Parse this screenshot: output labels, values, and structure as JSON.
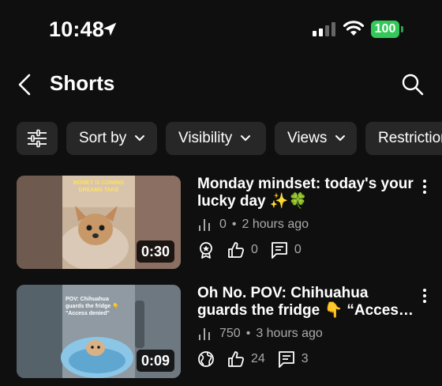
{
  "status_bar": {
    "time": "10:48",
    "battery": "100"
  },
  "header": {
    "title": "Shorts"
  },
  "filters": [
    {
      "label": "Sort by"
    },
    {
      "label": "Visibility"
    },
    {
      "label": "Views"
    },
    {
      "label": "Restrictions"
    }
  ],
  "videos": [
    {
      "title": "Monday mindset: today's your lucky day ✨🍀",
      "thumb_text": "MONEY IS COMING DREAMS TAKE",
      "duration": "0:30",
      "views": "0",
      "age": "2 hours ago",
      "likes": "0",
      "comments": "0",
      "visibility_icon": "award-icon"
    },
    {
      "title": "Oh No. POV: Chihuahua guards the fridge 👇 “Access denied” 🐶",
      "thumb_text": "POV: Chihuahua guards the fridge 👇 \"Access denied\"",
      "duration": "0:09",
      "views": "750",
      "age": "3 hours ago",
      "likes": "24",
      "comments": "3",
      "visibility_icon": "globe-icon"
    }
  ],
  "colors": {
    "background": "#0f0f0f",
    "chip": "#272727",
    "secondary_text": "#aaaaaa",
    "battery": "#34c759"
  }
}
